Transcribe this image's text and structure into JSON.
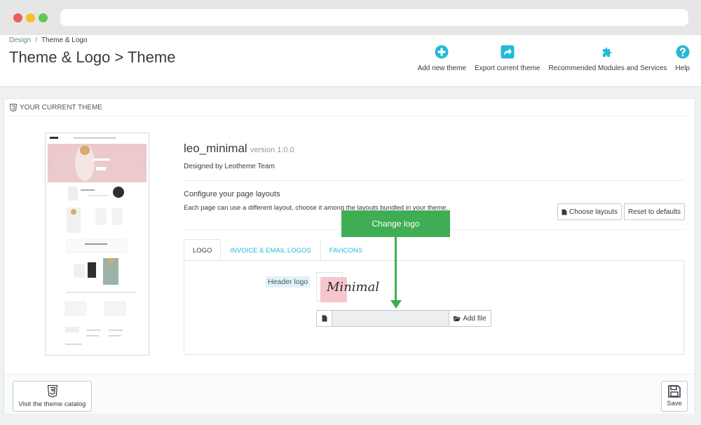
{
  "breadcrumb": {
    "parent": "Design",
    "separator": "/",
    "current": "Theme & Logo"
  },
  "page_title": "Theme & Logo > Theme",
  "toolbar": {
    "items": [
      {
        "label": "Add new theme",
        "icon": "plus-circle-icon"
      },
      {
        "label": "Export current theme",
        "icon": "export-share-icon"
      },
      {
        "label": "Recommended Modules and Services",
        "icon": "puzzle-icon"
      },
      {
        "label": "Help",
        "icon": "help-circle-icon"
      }
    ]
  },
  "panel": {
    "heading": "YOUR CURRENT THEME",
    "theme_name": "leo_minimal",
    "version": "version 1.0.0",
    "designed_by": "Designed by Leotheme Team",
    "configure_title": "Configure your page layouts",
    "configure_desc": "Each page can use a different layout, choose it among the layouts bundled in your theme.",
    "choose_layouts": "Choose layouts",
    "reset_defaults": "Reset to defaults",
    "tabs": [
      "LOGO",
      "INVOICE & EMAIL LOGOS",
      "FAVICONS"
    ],
    "header_logo_label": "Header logo",
    "logo_text": "Minimal",
    "add_file": "Add file",
    "footer": {
      "catalog_button": "Visit the theme catalog",
      "save_button": "Save"
    }
  },
  "annotation": {
    "label": "Change logo"
  },
  "colors": {
    "accent": "#25b9d7",
    "annotation_green": "#3fad53"
  }
}
